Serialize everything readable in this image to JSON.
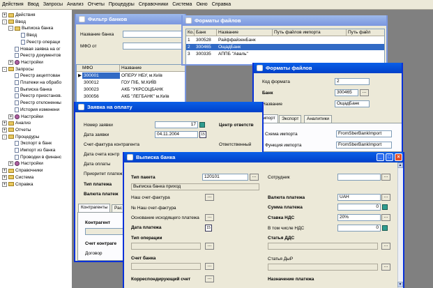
{
  "menu": [
    "Действия",
    "Ввод",
    "Запросы",
    "Анализ",
    "Отчеты",
    "Процедуры",
    "Справочники",
    "Система",
    "Окно",
    "Справка"
  ],
  "tree": [
    {
      "t": "Действия",
      "lvl": 0,
      "tog": "+",
      "ic": "fld"
    },
    {
      "t": "Ввод",
      "lvl": 0,
      "tog": "-",
      "ic": "fld"
    },
    {
      "t": "Выписка банка",
      "lvl": 1,
      "tog": "-",
      "ic": "fld"
    },
    {
      "t": "Ввод",
      "lvl": 2,
      "tog": "",
      "ic": "doc"
    },
    {
      "t": "Реестр операци",
      "lvl": 2,
      "tog": "",
      "ic": "doc"
    },
    {
      "t": "Новая заявка на ог",
      "lvl": 1,
      "tog": "",
      "ic": "doc"
    },
    {
      "t": "Реестр документов",
      "lvl": 1,
      "tog": "",
      "ic": "doc"
    },
    {
      "t": "Настройки",
      "lvl": 1,
      "tog": "+",
      "ic": "gear"
    },
    {
      "t": "Запросы",
      "lvl": 0,
      "tog": "-",
      "ic": "fld"
    },
    {
      "t": "Реестр акцептован",
      "lvl": 1,
      "tog": "",
      "ic": "doc"
    },
    {
      "t": "Платежи на обрабо",
      "lvl": 1,
      "tog": "",
      "ic": "doc"
    },
    {
      "t": "Выписка банка",
      "lvl": 1,
      "tog": "",
      "ic": "doc"
    },
    {
      "t": "Реестр приостанов.",
      "lvl": 1,
      "tog": "",
      "ic": "doc"
    },
    {
      "t": "Реестр отклоненны",
      "lvl": 1,
      "tog": "",
      "ic": "doc"
    },
    {
      "t": "История изменени",
      "lvl": 1,
      "tog": "",
      "ic": "doc"
    },
    {
      "t": "Настройки",
      "lvl": 1,
      "tog": "+",
      "ic": "gear"
    },
    {
      "t": "Анализ",
      "lvl": 0,
      "tog": "+",
      "ic": "fld"
    },
    {
      "t": "Отчеты",
      "lvl": 0,
      "tog": "+",
      "ic": "fld"
    },
    {
      "t": "Процедуры",
      "lvl": 0,
      "tog": "-",
      "ic": "fld"
    },
    {
      "t": "Экспорт в банк",
      "lvl": 1,
      "tog": "",
      "ic": "doc"
    },
    {
      "t": "Импорт из банка",
      "lvl": 1,
      "tog": "",
      "ic": "doc"
    },
    {
      "t": "Проводки в финанс",
      "lvl": 1,
      "tog": "",
      "ic": "doc"
    },
    {
      "t": "Настройки",
      "lvl": 1,
      "tog": "+",
      "ic": "gear"
    },
    {
      "t": "Справочники",
      "lvl": 0,
      "tog": "+",
      "ic": "fld"
    },
    {
      "t": "Система",
      "lvl": 0,
      "tog": "+",
      "ic": "fld"
    },
    {
      "t": "Справка",
      "lvl": 0,
      "tog": "+",
      "ic": "fld"
    }
  ],
  "bank_filter": {
    "title": "Фильтр банков",
    "name_label": "Название банка",
    "mfo_label": "МФО от",
    "cut_label": "до",
    "col_mfo": "МФО",
    "col_name": "Название",
    "rows": [
      {
        "mfo": "300001",
        "name": "ОПЕРУ НБУ, м.Київ"
      },
      {
        "mfo": "300012",
        "name": "ГОУ ПІБ, М.КИЇВ"
      },
      {
        "mfo": "300023",
        "name": "АКБ \"УКРСОЦБАНК"
      },
      {
        "mfo": "300056",
        "name": "АКБ \"ЛЕГБАНК\" м.Київ"
      }
    ]
  },
  "formats": {
    "title": "Форматы файлов",
    "cols": [
      "Ко...",
      "Банк",
      "Название",
      "Путь файлов импорта",
      "Путь файл"
    ],
    "rows": [
      {
        "k": "1",
        "bank": "300528",
        "name": "РайффайзенБанк",
        "path": "",
        "path2": ""
      },
      {
        "k": "2",
        "bank": "300465",
        "name": "ОщадБанк",
        "path": "",
        "path2": ""
      },
      {
        "k": "3",
        "bank": "300335",
        "name": "АППБ \"Аваль\"",
        "path": "",
        "path2": ""
      }
    ]
  },
  "format_edit": {
    "title": "Форматы файлов",
    "code_label": "Код формата",
    "code_value": "2",
    "bank_label": "Банк",
    "bank_value": "300465",
    "name_label": "Название",
    "name_value": "ОщадБанк",
    "tabs": [
      "Импорт",
      "Экспорт",
      "Аналитики"
    ],
    "scheme_label": "Схема импорта",
    "scheme_value": "FromSberBankImport",
    "func_label": "Функция импорта",
    "func_value": "FromSberBankImport"
  },
  "payment": {
    "title": "Заявка на оплату",
    "num_label": "Номер заявки",
    "num_value": "17",
    "date_label": "Дата заявки",
    "date_value": "04.11.2004",
    "invoice_label": "Счет-фактура контрагента",
    "invoice_date_label": "Дата счета контр",
    "pay_date_label": "Дата оплаты",
    "priority_label": "Приоритет платеж",
    "type_label": "Тип платежа",
    "currency_label": "Валюта платеж",
    "center_label": "Центр ответств",
    "resp_label": "Ответственный",
    "tabs": [
      "Контрагенты",
      "Рас"
    ],
    "contragent_label": "Контрагент",
    "contragent_acc_label": "Счет контраге",
    "contract_label": "Договор"
  },
  "statement": {
    "title": "Выписка банка",
    "packet_type_label": "Тип пакета",
    "packet_type_value": "120101",
    "packet_desc": "Выписка банка приход",
    "employee_label": "Сотрудник",
    "our_invoice_label": "Наш счет-фактура",
    "our_invoice_num_label": "№ Наш счет-фактура",
    "basis_label": "Основание исходящего платежа",
    "pay_date_label": "Дата платежа",
    "op_type_label": "Тип операции",
    "bank_acc_label": "Счет банка",
    "corr_acc_label": "Корреспондирующий счет",
    "currency_label": "Валюта платежа",
    "currency_value": "UAH",
    "sum_label": "Сумма платежа",
    "sum_value": "0",
    "vat_rate_label": "Ставка НДС",
    "vat_rate_value": "20%",
    "vat_incl_label": "В том числе НДС",
    "vat_incl_value": "0",
    "dds_label": "Статья ДДС",
    "dyr_label": "Статья ДыР",
    "purpose_label": "Назначение платежа"
  }
}
